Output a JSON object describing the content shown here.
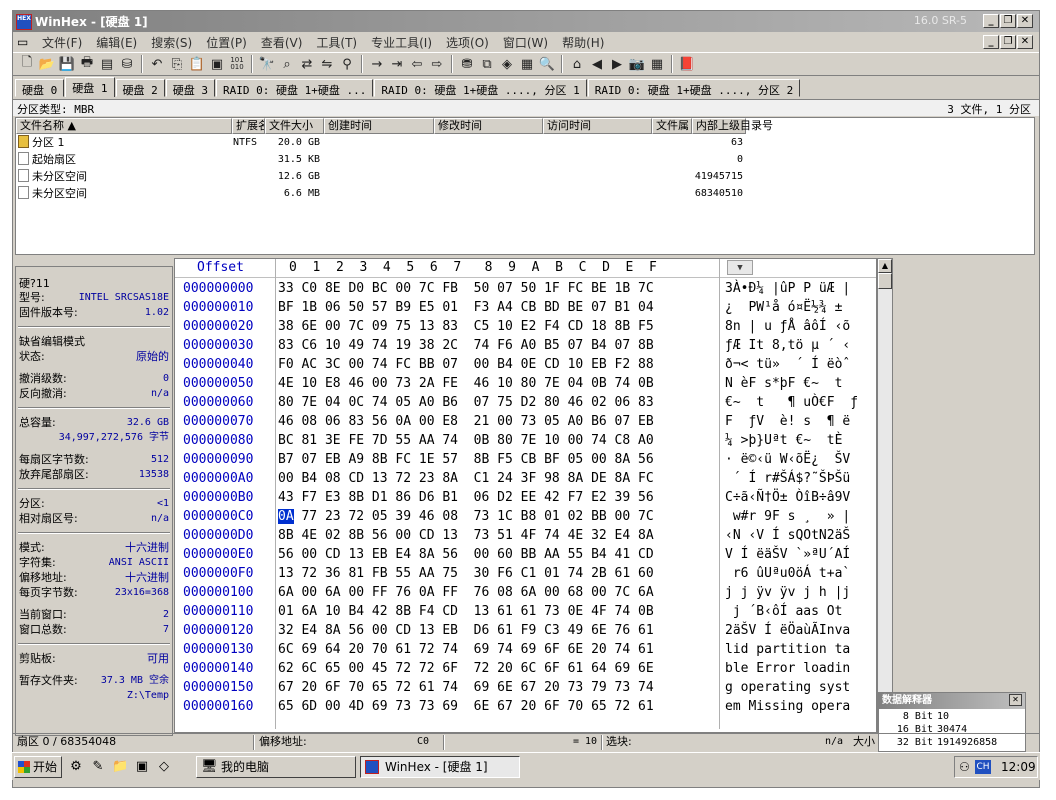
{
  "window": {
    "title": "WinHex - [硬盘 1]",
    "version": "16.0 SR-5",
    "app_icon_text": "HEX"
  },
  "menu": [
    "文件(F)",
    "编辑(E)",
    "搜索(S)",
    "位置(P)",
    "查看(V)",
    "工具(T)",
    "专业工具(I)",
    "选项(O)",
    "窗口(W)",
    "帮助(H)"
  ],
  "tabs": [
    "硬盘 0",
    "硬盘 1",
    "硬盘 2",
    "硬盘 3",
    "RAID 0: 硬盘 1+硬盘 ...",
    "RAID 0: 硬盘 1+硬盘 ...., 分区 1",
    "RAID 0: 硬盘 1+硬盘 ...., 分区 2"
  ],
  "active_tab": 1,
  "partition": {
    "type_label": "分区类型: MBR",
    "summary": "3 文件, 1 分区"
  },
  "file_columns": [
    "文件名称",
    "扩展名",
    "文件大小",
    "创建时间",
    "修改时间",
    "访问时间",
    "文件属",
    "内部上级目录号"
  ],
  "files": [
    {
      "name": "分区 1",
      "ext": "NTFS",
      "size": "20.0 GB",
      "parent": "63"
    },
    {
      "name": "起始扇区",
      "ext": "",
      "size": "31.5 KB",
      "parent": "0"
    },
    {
      "name": "未分区空间",
      "ext": "",
      "size": "12.6 GB",
      "parent": "41945715"
    },
    {
      "name": "未分区空间",
      "ext": "",
      "size": "6.6 MB",
      "parent": "68340510"
    }
  ],
  "info": {
    "device": "硬?11",
    "model_k": "型号:",
    "model_v": "INTEL  SRCSAS18E",
    "firmware_k": "固件版本号:",
    "firmware_v": "1.02",
    "edit_mode": "缺省编辑模式",
    "state_k": "状态:",
    "state_v": "原始的",
    "undo_level_k": "撤消级数:",
    "undo_level_v": "0",
    "undo_rev_k": "反向撤消:",
    "undo_rev_v": "n/a",
    "capacity_k": "总容量:",
    "capacity_v": "32.6 GB",
    "capacity_bytes": "34,997,272,576 字节",
    "bps_k": "每扇区字节数:",
    "bps_v": "512",
    "spare_k": "放弃尾部扇区:",
    "spare_v": "13538",
    "partition_k": "分区:",
    "partition_v": "<1",
    "relsec_k": "相对扇区号:",
    "relsec_v": "n/a",
    "mode_k": "模式:",
    "mode_v": "十六进制",
    "charset_k": "字符集:",
    "charset_v": "ANSI ASCII",
    "offaddr_k": "偏移地址:",
    "offaddr_v": "十六进制",
    "bpp_k": "每页字节数:",
    "bpp_v": "23x16=368",
    "curwin_k": "当前窗口:",
    "curwin_v": "2",
    "wincount_k": "窗口总数:",
    "wincount_v": "7",
    "clip_k": "剪贴板:",
    "clip_v": "可用",
    "temp_k": "暂存文件夹:",
    "temp_v": "37.3 MB 空余",
    "temp_path": "Z:\\Temp"
  },
  "hex": {
    "header_offset": "Offset",
    "header_cols": "0  1  2  3  4  5  6  7   8  9  A  B  C  D  E  F",
    "rows": [
      {
        "off": "000000000",
        "b": "33 C0 8E D0 BC 00 7C FB  50 07 50 1F FC BE 1B 7C",
        "a": "3À•Ð¼ |ûP P üÆ |"
      },
      {
        "off": "000000010",
        "b": "BF 1B 06 50 57 B9 E5 01  F3 A4 CB BD BE 07 B1 04",
        "a": "¿  PW¹å ó¤Ë½¾ ±"
      },
      {
        "off": "000000020",
        "b": "38 6E 00 7C 09 75 13 83  C5 10 E2 F4 CD 18 8B F5",
        "a": "8n | u ƒÅ âôÍ ‹õ"
      },
      {
        "off": "000000030",
        "b": "83 C6 10 49 74 19 38 2C  74 F6 A0 B5 07 B4 07 8B",
        "a": "ƒÆ It 8,tö µ ´ ‹"
      },
      {
        "off": "000000040",
        "b": "F0 AC 3C 00 74 FC BB 07  00 B4 0E CD 10 EB F2 88",
        "a": "ð¬< tü»  ´ Í ëòˆ"
      },
      {
        "off": "000000050",
        "b": "4E 10 E8 46 00 73 2A FE  46 10 80 7E 04 0B 74 0B",
        "a": "N èF s*þF €~  t"
      },
      {
        "off": "000000060",
        "b": "80 7E 04 0C 74 05 A0 B6  07 75 D2 80 46 02 06 83",
        "a": "€~  t   ¶ uÒ€F  ƒ"
      },
      {
        "off": "000000070",
        "b": "46 08 06 83 56 0A 00 E8  21 00 73 05 A0 B6 07 EB",
        "a": "F  ƒV  è! s  ¶ ë"
      },
      {
        "off": "000000080",
        "b": "BC 81 3E FE 7D 55 AA 74  0B 80 7E 10 00 74 C8 A0",
        "a": "¼ >þ}Uªt €~  tÈ "
      },
      {
        "off": "000000090",
        "b": "B7 07 EB A9 8B FC 1E 57  8B F5 CB BF 05 00 8A 56",
        "a": "· ë©‹ü W‹õË¿  ŠV"
      },
      {
        "off": "0000000A0",
        "b": "00 B4 08 CD 13 72 23 8A  C1 24 3F 98 8A DE 8A FC",
        "a": " ´ Í r#ŠÁ$?˜ŠÞŠü"
      },
      {
        "off": "0000000B0",
        "b": "43 F7 E3 8B D1 86 D6 B1  06 D2 EE 42 F7 E2 39 56",
        "a": "C÷ã‹Ñ†Ö± ÒîB÷â9V"
      },
      {
        "off": "0000000C0",
        "b": "0A 77 23 72 05 39 46 08  73 1C B8 01 02 BB 00 7C",
        "a": " w#r 9F s ¸  » |"
      },
      {
        "off": "0000000D0",
        "b": "8B 4E 02 8B 56 00 CD 13  73 51 4F 74 4E 32 E4 8A",
        "a": "‹N ‹V Í sQOtN2äŠ"
      },
      {
        "off": "0000000E0",
        "b": "56 00 CD 13 EB E4 8A 56  00 60 BB AA 55 B4 41 CD",
        "a": "V Í ëäŠV `»ªU´AÍ"
      },
      {
        "off": "0000000F0",
        "b": "13 72 36 81 FB 55 AA 75  30 F6 C1 01 74 2B 61 60",
        "a": " r6 ûUªu0öÁ t+a`"
      },
      {
        "off": "000000100",
        "b": "6A 00 6A 00 FF 76 0A FF  76 08 6A 00 68 00 7C 6A",
        "a": "j j ÿv ÿv j h |j"
      },
      {
        "off": "000000110",
        "b": "01 6A 10 B4 42 8B F4 CD  13 61 61 73 0E 4F 74 0B",
        "a": " j ´B‹ôÍ aas Ot"
      },
      {
        "off": "000000120",
        "b": "32 E4 8A 56 00 CD 13 EB  D6 61 F9 C3 49 6E 76 61",
        "a": "2äŠV Í ëÖaùÃInva"
      },
      {
        "off": "000000130",
        "b": "6C 69 64 20 70 61 72 74  69 74 69 6F 6E 20 74 61",
        "a": "lid partition ta"
      },
      {
        "off": "000000140",
        "b": "62 6C 65 00 45 72 72 6F  72 20 6C 6F 61 64 69 6E",
        "a": "ble Error loadin"
      },
      {
        "off": "000000150",
        "b": "67 20 6F 70 65 72 61 74  69 6E 67 20 73 79 73 74",
        "a": "g operating syst"
      },
      {
        "off": "000000160",
        "b": "65 6D 00 4D 69 73 73 69  6E 67 20 6F 70 65 72 61",
        "a": "em Missing opera"
      }
    ],
    "cursor_row": 12,
    "cursor_byte": "0A"
  },
  "interpreter": {
    "title": "数据解释器",
    "rows": [
      {
        "k": "8 Bit",
        "v": "10"
      },
      {
        "k": "16 Bit",
        "v": "30474"
      },
      {
        "k": "32 Bit",
        "v": "1914926858"
      }
    ]
  },
  "status": {
    "sector": "扇区 0 / 68354048",
    "offset_label": "偏移地址:",
    "offset_value": "C0",
    "value": "= 10",
    "block_label": "选块:",
    "block_value": "n/a",
    "size_label": "大小"
  },
  "taskbar": {
    "start": "开始",
    "tasks": [
      "我的电脑",
      "WinHex - [硬盘 1]"
    ],
    "ime": "CH",
    "clock": "12:09"
  }
}
